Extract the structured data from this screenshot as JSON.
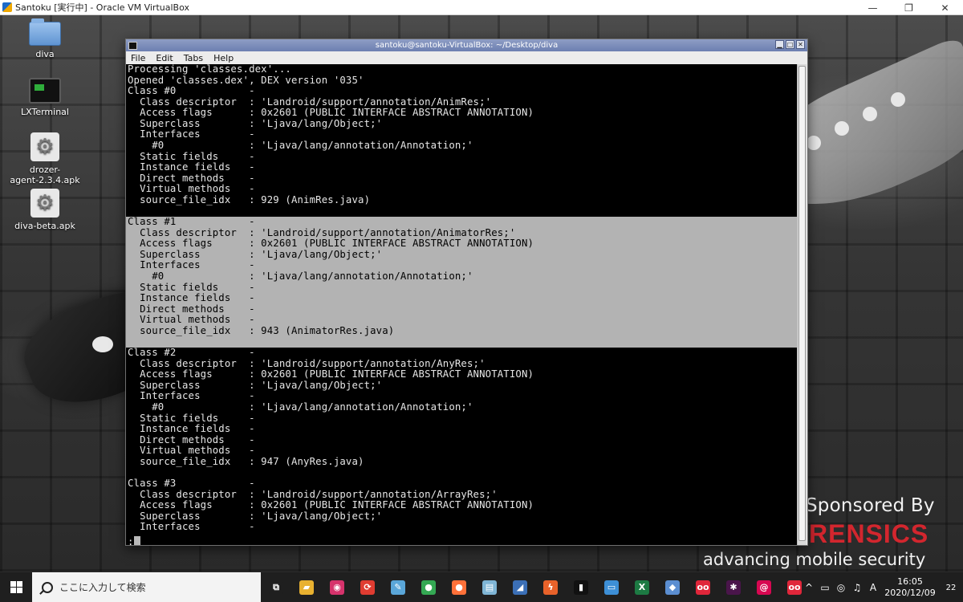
{
  "vbox": {
    "title": "Santoku [実行中] - Oracle VM VirtualBox",
    "minimize": "—",
    "restore": "❐",
    "close": "✕"
  },
  "desktop_icons": [
    {
      "label": "diva",
      "icon": "folder-icon"
    },
    {
      "label": "LXTerminal",
      "icon": "terminal-icon"
    },
    {
      "label": "drozer-\nagent-2.3.4.apk",
      "icon": "apk-gear-icon"
    },
    {
      "label": "diva-beta.apk",
      "icon": "apk-gear-icon"
    }
  ],
  "terminal": {
    "title": "santoku@santoku-VirtualBox: ~/Desktop/diva",
    "menu": [
      "File",
      "Edit",
      "Tabs",
      "Help"
    ],
    "lines": [
      "Processing 'classes.dex'...",
      "Opened 'classes.dex', DEX version '035'",
      "Class #0            -",
      "  Class descriptor  : 'Landroid/support/annotation/AnimRes;'",
      "  Access flags      : 0x2601 (PUBLIC INTERFACE ABSTRACT ANNOTATION)",
      "  Superclass        : 'Ljava/lang/Object;'",
      "  Interfaces        -",
      "    #0              : 'Ljava/lang/annotation/Annotation;'",
      "  Static fields     -",
      "  Instance fields   -",
      "  Direct methods    -",
      "  Virtual methods   -",
      "  source_file_idx   : 929 (AnimRes.java)",
      "",
      "Class #1            -",
      "  Class descriptor  : 'Landroid/support/annotation/AnimatorRes;'",
      "  Access flags      : 0x2601 (PUBLIC INTERFACE ABSTRACT ANNOTATION)",
      "  Superclass        : 'Ljava/lang/Object;'",
      "  Interfaces        -",
      "    #0              : 'Ljava/lang/annotation/Annotation;'",
      "  Static fields     -",
      "  Instance fields   -",
      "  Direct methods    -",
      "  Virtual methods   -",
      "  source_file_idx   : 943 (AnimatorRes.java)",
      "",
      "Class #2            -",
      "  Class descriptor  : 'Landroid/support/annotation/AnyRes;'",
      "  Access flags      : 0x2601 (PUBLIC INTERFACE ABSTRACT ANNOTATION)",
      "  Superclass        : 'Ljava/lang/Object;'",
      "  Interfaces        -",
      "    #0              : 'Ljava/lang/annotation/Annotation;'",
      "  Static fields     -",
      "  Instance fields   -",
      "  Direct methods    -",
      "  Virtual methods   -",
      "  source_file_idx   : 947 (AnyRes.java)",
      "",
      "Class #3            -",
      "  Class descriptor  : 'Landroid/support/annotation/ArrayRes;'",
      "  Access flags      : 0x2601 (PUBLIC INTERFACE ABSTRACT ANNOTATION)",
      "  Superclass        : 'Ljava/lang/Object;'",
      "  Interfaces        -",
      ":"
    ],
    "highlighted_range": [
      14,
      25
    ]
  },
  "wallpaper": {
    "sponsor_text": "Sponsored By",
    "brand_text": "RENSICS",
    "tagline": "advancing mobile security",
    "brand_color": "#d3262e"
  },
  "taskbar": {
    "search_placeholder": "ここに入力して検索",
    "apps": [
      {
        "name": "task-view-icon",
        "glyph": "⧉",
        "color": "#1f1f1f"
      },
      {
        "name": "file-explorer-icon",
        "glyph": "▰",
        "color": "#e8b130"
      },
      {
        "name": "app-pink-icon",
        "glyph": "◉",
        "color": "#d6336c"
      },
      {
        "name": "app-sync-icon",
        "glyph": "⟳",
        "color": "#e03c31"
      },
      {
        "name": "paint-icon",
        "glyph": "✎",
        "color": "#5aa6d8"
      },
      {
        "name": "chrome-icon",
        "glyph": "●",
        "color": "#34a853"
      },
      {
        "name": "firefox-icon",
        "glyph": "●",
        "color": "#ff7139"
      },
      {
        "name": "notes-icon",
        "glyph": "▤",
        "color": "#7fb5d5"
      },
      {
        "name": "wireshark-icon",
        "glyph": "◢",
        "color": "#3b6fb6"
      },
      {
        "name": "burp-icon",
        "glyph": "ϟ",
        "color": "#e8622a"
      },
      {
        "name": "terminal-icon",
        "glyph": "▮",
        "color": "#111111"
      },
      {
        "name": "remote-desktop-icon",
        "glyph": "▭",
        "color": "#3d8fd6"
      },
      {
        "name": "excel-icon",
        "glyph": "X",
        "color": "#1d7a43"
      },
      {
        "name": "virtualbox-icon",
        "glyph": "◆",
        "color": "#5b8ed1"
      },
      {
        "name": "app-red-circle-icon",
        "glyph": "oo",
        "color": "#e0263a"
      },
      {
        "name": "slack-icon",
        "glyph": "✱",
        "color": "#4a154b"
      },
      {
        "name": "debian-icon",
        "glyph": "@",
        "color": "#d70751"
      },
      {
        "name": "app-oo-icon",
        "glyph": "oo",
        "color": "#e0263a"
      }
    ],
    "tray_icons": [
      "^",
      "▭",
      "◎",
      "♫",
      "A"
    ],
    "time": "16:05",
    "date": "2020/12/09",
    "notifications": "22"
  }
}
